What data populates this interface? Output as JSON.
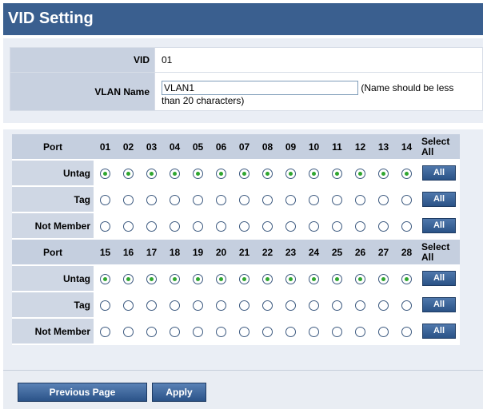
{
  "title": "VID Setting",
  "vid": {
    "label": "VID",
    "value": "01"
  },
  "vlan_name": {
    "label": "VLAN Name",
    "value": "VLAN1",
    "hint_part1": "(Name should be less",
    "hint_part2": "than 20 characters)"
  },
  "membership": {
    "port_label": "Port",
    "select_all_label": "Select All",
    "all_button_label": "All",
    "groups": [
      {
        "ports": [
          "01",
          "02",
          "03",
          "04",
          "05",
          "06",
          "07",
          "08",
          "09",
          "10",
          "11",
          "12",
          "13",
          "14"
        ],
        "rows": [
          {
            "label": "Untag",
            "selected": true
          },
          {
            "label": "Tag",
            "selected": false
          },
          {
            "label": "Not Member",
            "selected": false
          }
        ]
      },
      {
        "ports": [
          "15",
          "16",
          "17",
          "18",
          "19",
          "20",
          "21",
          "22",
          "23",
          "24",
          "25",
          "26",
          "27",
          "28"
        ],
        "rows": [
          {
            "label": "Untag",
            "selected": true
          },
          {
            "label": "Tag",
            "selected": false
          },
          {
            "label": "Not Member",
            "selected": false
          }
        ]
      }
    ]
  },
  "buttons": {
    "previous": "Previous Page",
    "apply": "Apply"
  }
}
